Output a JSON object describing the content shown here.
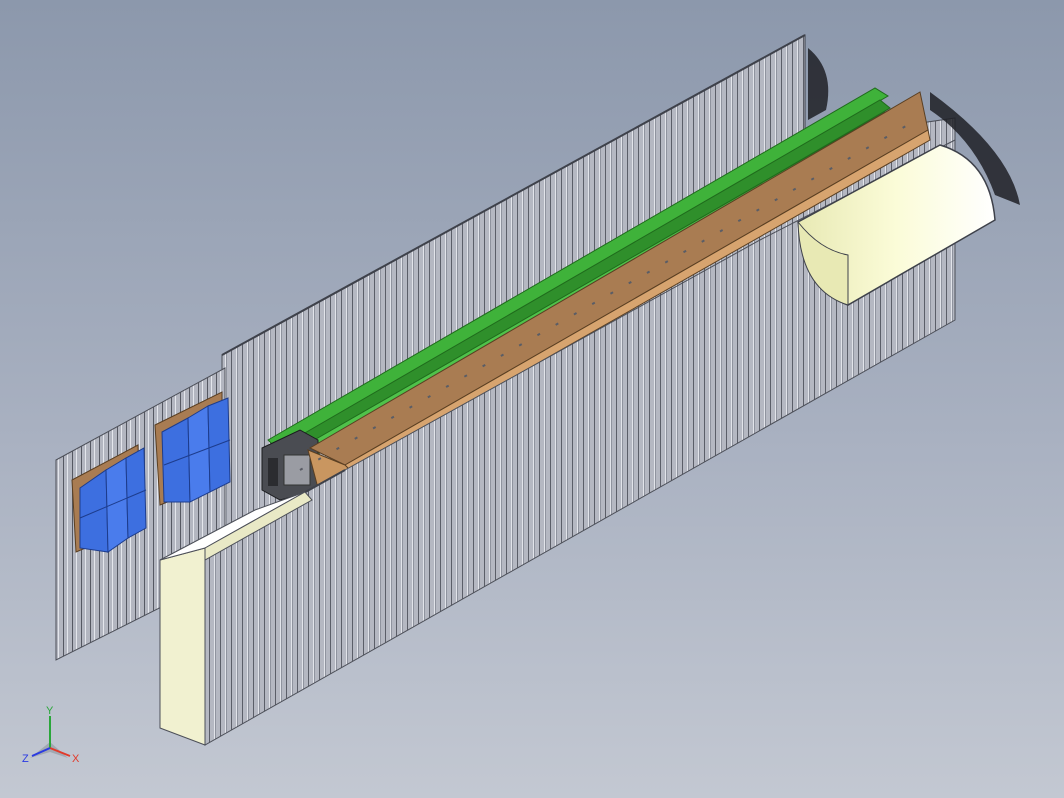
{
  "viewport": {
    "background_top": "#8c98ac",
    "background_bottom": "#c3c8d2"
  },
  "model": {
    "wall_color": "#b7bac4",
    "wall_rib_color": "#5b5e68",
    "beam_color": "#a97c52",
    "rail_color": "#3fb23a",
    "end_block_color": "#f1f1d0",
    "hood_color": "#f5f6c8",
    "panel_color": "#3d6fe0"
  },
  "triad": {
    "x_label": "X",
    "y_label": "Y",
    "z_label": "Z",
    "x_color": "#e23a2a",
    "y_color": "#2aa63a",
    "z_color": "#2a3ae2"
  }
}
